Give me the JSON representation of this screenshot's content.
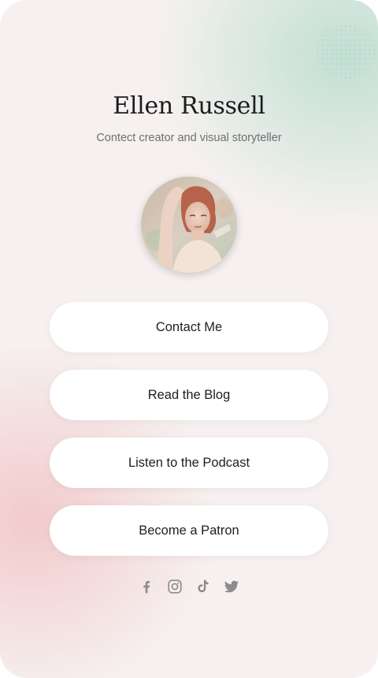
{
  "profile": {
    "name": "Ellen Russell",
    "tagline": "Contect creator and visual storyteller"
  },
  "links": [
    {
      "label": "Contact Me"
    },
    {
      "label": "Read the Blog"
    },
    {
      "label": "Listen to the Podcast"
    },
    {
      "label": "Become a Patron"
    }
  ],
  "socials": [
    {
      "icon": "facebook-icon"
    },
    {
      "icon": "instagram-icon"
    },
    {
      "icon": "tiktok-icon"
    },
    {
      "icon": "twitter-icon"
    }
  ],
  "colors": {
    "background": "#f6f1f0",
    "mint_glow": "#beded2",
    "pink_glow": "#f2c6c8",
    "button": "#ffffff",
    "text": "#1e1e1e",
    "icon": "#8c8c8c"
  }
}
